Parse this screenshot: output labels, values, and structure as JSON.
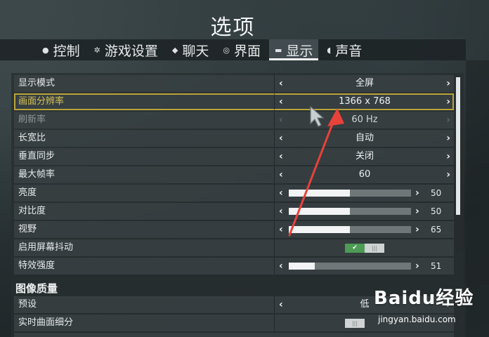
{
  "title": "选项",
  "tabs": [
    {
      "label": "控制",
      "icon": "mouse-icon"
    },
    {
      "label": "游戏设置",
      "icon": "gear-icon"
    },
    {
      "label": "聊天",
      "icon": "chat-icon"
    },
    {
      "label": "界面",
      "icon": "interface-icon"
    },
    {
      "label": "显示",
      "icon": "monitor-icon",
      "active": true
    },
    {
      "label": "声音",
      "icon": "speaker-icon"
    }
  ],
  "settings": {
    "display_mode": {
      "label": "显示模式",
      "value": "全屏"
    },
    "resolution": {
      "label": "画面分辨率",
      "value": "1366 x 768"
    },
    "refresh_rate": {
      "label": "刷新率",
      "value": "60 Hz"
    },
    "aspect_ratio": {
      "label": "长宽比",
      "value": "自动"
    },
    "vsync": {
      "label": "垂直同步",
      "value": "关闭"
    },
    "max_fps": {
      "label": "最大帧率",
      "value": "60"
    },
    "brightness": {
      "label": "亮度",
      "value": "50",
      "fraction": 0.5
    },
    "contrast": {
      "label": "对比度",
      "value": "50",
      "fraction": 0.5
    },
    "fov": {
      "label": "视野",
      "value": "65",
      "fraction": 0.5
    },
    "screen_shake": {
      "label": "启用屏幕抖动",
      "state": "on"
    },
    "effects_intensity": {
      "label": "特效强度",
      "value": "51",
      "fraction": 0.21
    }
  },
  "image_quality": {
    "heading": "图像质量",
    "preset": {
      "label": "预设",
      "value": "低"
    },
    "tessellation": {
      "label": "实时曲面细分",
      "state": "off"
    }
  },
  "icons": {
    "left": "‹",
    "right": "›"
  },
  "watermark": {
    "logo": "Baidu经验",
    "url": "jingyan.baidu.com"
  },
  "colors": {
    "selected_outline": "#b9a43a",
    "toggle_on": "#4d9b55",
    "annotation_arrow": "#e8423a"
  }
}
